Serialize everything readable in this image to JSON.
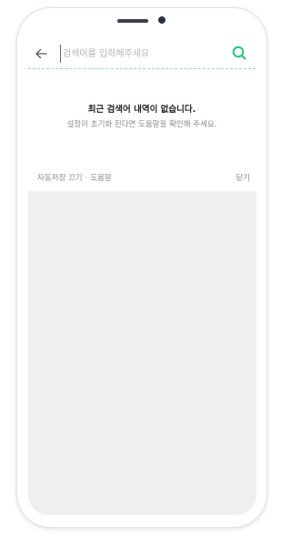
{
  "search": {
    "placeholder": "검색어를 입력해주세요"
  },
  "empty_state": {
    "title": "최근 검색어 내역이 없습니다.",
    "subtitle": "설정이 초기화 된다면 도움말을 확인해 주세요."
  },
  "footer": {
    "autosave_label": "자동저장 끄기",
    "separator": "·",
    "help_label": "도움말",
    "close_label": "닫기"
  },
  "colors": {
    "accent": "#2ec27e",
    "divider": "#8fdcb0",
    "panel_background": "#efefef"
  },
  "icons": {
    "back": "arrow-left-icon",
    "search": "search-icon"
  }
}
